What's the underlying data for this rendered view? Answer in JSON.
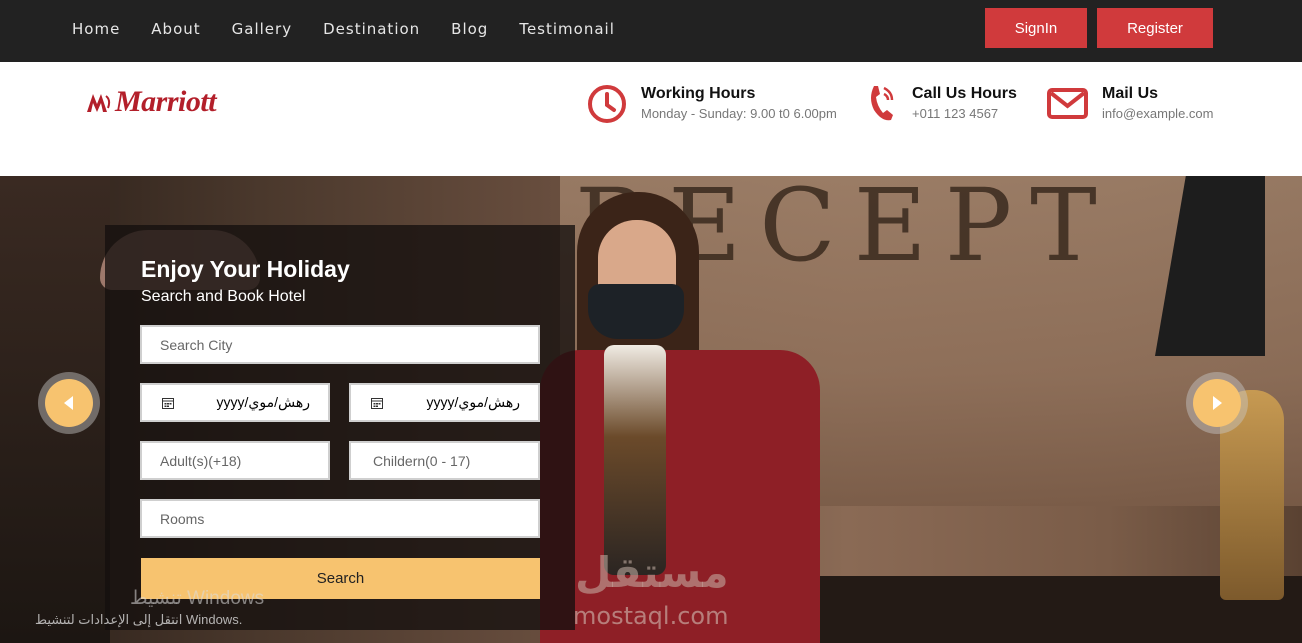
{
  "nav": {
    "links": [
      "Home",
      "About",
      "Gallery",
      "Destination",
      "Blog",
      "Testimonail"
    ],
    "signin_label": "SignIn",
    "register_label": "Register"
  },
  "brand": {
    "logo_text": "Marriott",
    "color": "#b31f2a"
  },
  "info": {
    "hours_title": "Working Hours",
    "hours_sub": "Monday - Sunday: 9.00 t0 6.00pm",
    "call_title": "Call Us Hours",
    "call_sub": "+011 123 4567",
    "mail_title": "Mail Us",
    "mail_sub": "info@example.com",
    "icon_color": "#d03a3c"
  },
  "hero": {
    "sign_letters": "RECEPT"
  },
  "form": {
    "title": "Enjoy Your Holiday",
    "subtitle": "Search and Book Hotel",
    "city_placeholder": "Search City",
    "date1_value": "yyyy/رهش/موي",
    "date2_value": "yyyy/رهش/موي",
    "adults_placeholder": "Adult(s)(+18)",
    "children_placeholder": "Childern(0 - 17)",
    "rooms_placeholder": "Rooms",
    "search_label": "Search",
    "accent": "#f7c36f"
  },
  "overlay": {
    "windows_title": "تنشيط Windows",
    "windows_sub": "انتقل إلى الإعدادات لتنشيط Windows.",
    "watermark_ar": "مستقل",
    "watermark": "mostaql.com"
  }
}
